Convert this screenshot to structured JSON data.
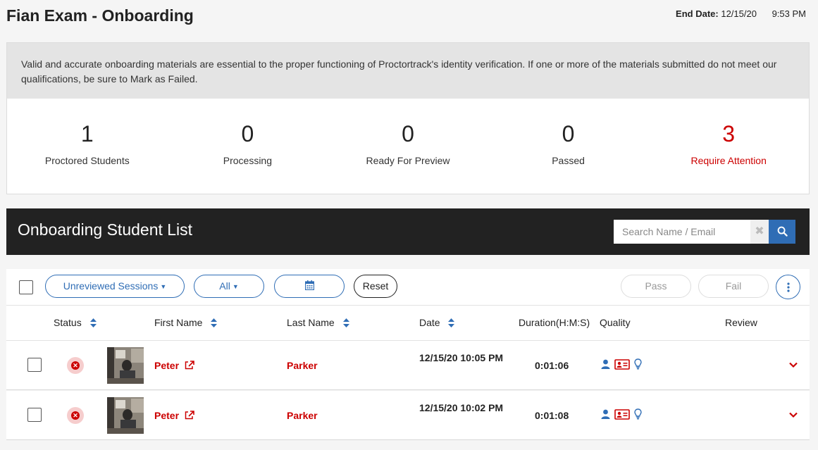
{
  "page": {
    "title": "Fian Exam - Onboarding",
    "end_date_label": "End Date:",
    "end_date": "12/15/20",
    "end_time": "9:53 PM"
  },
  "info": {
    "message": "Valid and accurate onboarding materials are essential to the proper functioning of Proctortrack's identity verification. If one or more of the materials submitted do not meet our qualifications, be sure to Mark as Failed."
  },
  "stats": [
    {
      "value": "1",
      "label": "Proctored Students"
    },
    {
      "value": "0",
      "label": "Processing"
    },
    {
      "value": "0",
      "label": "Ready For Preview"
    },
    {
      "value": "0",
      "label": "Passed"
    },
    {
      "value": "3",
      "label": "Require Attention"
    }
  ],
  "list": {
    "title": "Onboarding Student List",
    "search_placeholder": "Search Name / Email",
    "clear_glyph": "✖"
  },
  "toolbar": {
    "session_filter": "Unreviewed Sessions",
    "type_filter": "All",
    "reset_label": "Reset",
    "pass_label": "Pass",
    "fail_label": "Fail"
  },
  "columns": {
    "status": "Status",
    "first_name": "First Name",
    "last_name": "Last Name",
    "date": "Date",
    "duration": "Duration(H:M:S)",
    "quality": "Quality",
    "review": "Review"
  },
  "rows": [
    {
      "first_name": "Peter",
      "last_name": "Parker",
      "date": "12/15/20 10:05 PM",
      "duration": "0:01:06"
    },
    {
      "first_name": "Peter",
      "last_name": "Parker",
      "date": "12/15/20 10:02 PM",
      "duration": "0:01:08"
    }
  ],
  "colors": {
    "accent_blue": "#2f6db5",
    "alert_red": "#cc0000",
    "header_dark": "#222222"
  }
}
